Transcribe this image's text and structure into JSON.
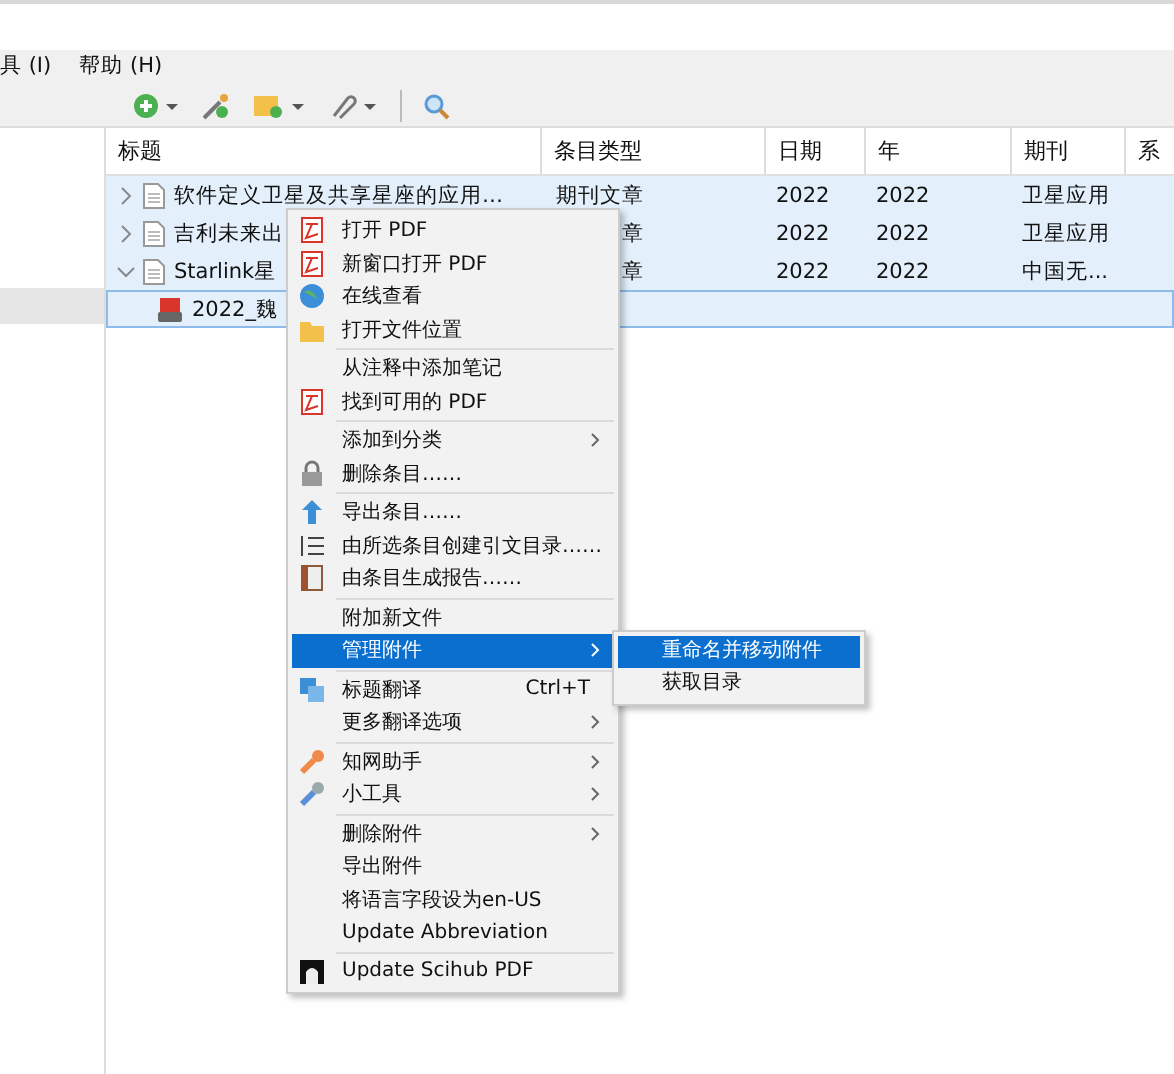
{
  "menubar": [
    {
      "label": "具 (I)"
    },
    {
      "label": "帮助 (H)"
    }
  ],
  "table": {
    "columns": [
      "标题",
      "条目类型",
      "日期",
      "年",
      "期刊",
      "系"
    ],
    "rows": [
      {
        "title": "软件定义卫星及共享星座的应用…",
        "type": "期刊文章",
        "date": "2022",
        "year": "2022",
        "journal": "卫星应用",
        "expanded": false,
        "selected": true
      },
      {
        "title": "吉利未来出",
        "type": "章",
        "date": "2022",
        "year": "2022",
        "journal": "卫星应用",
        "expanded": false,
        "selected": true
      },
      {
        "title": "Starlink星",
        "type": "章",
        "date": "2022",
        "year": "2022",
        "journal": "中国无...",
        "expanded": true,
        "selected": true,
        "children": [
          {
            "title": "2022_魏",
            "selected": true
          }
        ]
      }
    ]
  },
  "context_menu": {
    "sections": [
      [
        {
          "label": "打开 PDF",
          "submenu": false,
          "selected": false
        },
        {
          "label": "新窗口打开 PDF",
          "submenu": false,
          "selected": false
        },
        {
          "label": "在线查看",
          "submenu": false,
          "selected": false
        },
        {
          "label": "打开文件位置",
          "submenu": false,
          "selected": false
        }
      ],
      [
        {
          "label": "从注释中添加笔记",
          "submenu": false,
          "selected": false
        },
        {
          "label": "找到可用的 PDF",
          "submenu": false,
          "selected": false
        }
      ],
      [
        {
          "label": "添加到分类",
          "submenu": true,
          "selected": false
        },
        {
          "label": "删除条目……",
          "submenu": false,
          "selected": false
        }
      ],
      [
        {
          "label": "导出条目……",
          "submenu": false,
          "selected": false
        },
        {
          "label": "由所选条目创建引文目录……",
          "submenu": false,
          "selected": false
        },
        {
          "label": "由条目生成报告……",
          "submenu": false,
          "selected": false
        }
      ],
      [
        {
          "label": "附加新文件",
          "submenu": false,
          "selected": false
        },
        {
          "label": "管理附件",
          "submenu": true,
          "selected": true
        }
      ],
      [
        {
          "label": "标题翻译",
          "shortcut": "Ctrl+T",
          "submenu": false,
          "selected": false
        },
        {
          "label": "更多翻译选项",
          "submenu": true,
          "selected": false
        }
      ],
      [
        {
          "label": "知网助手",
          "submenu": true,
          "selected": false
        },
        {
          "label": "小工具",
          "submenu": true,
          "selected": false
        }
      ],
      [
        {
          "label": "删除附件",
          "submenu": true,
          "selected": false
        },
        {
          "label": "导出附件",
          "submenu": false,
          "selected": false
        },
        {
          "label": "将语言字段设为en-US",
          "submenu": false,
          "selected": false
        },
        {
          "label": "Update Abbreviation",
          "submenu": false,
          "selected": false
        }
      ],
      [
        {
          "label": "Update Scihub PDF",
          "submenu": false,
          "selected": false
        }
      ]
    ]
  },
  "submenu": [
    {
      "label": "重命名并移动附件",
      "selected": true
    },
    {
      "label": "获取目录",
      "selected": false
    }
  ]
}
